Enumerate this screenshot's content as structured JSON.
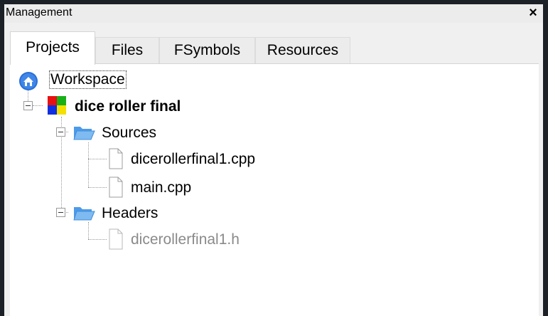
{
  "panel": {
    "title": "Management",
    "close_glyph": "×"
  },
  "tabs": [
    {
      "label": "Projects",
      "active": true
    },
    {
      "label": "Files",
      "active": false
    },
    {
      "label": "FSymbols",
      "active": false
    },
    {
      "label": "Resources",
      "active": false
    }
  ],
  "tree": {
    "workspace": {
      "label": "Workspace",
      "icon": "workspace-globe-icon"
    },
    "project": {
      "label": "dice roller final",
      "icon": "project-icon"
    },
    "sources": {
      "label": "Sources",
      "icon": "folder-icon",
      "files": [
        {
          "label": "dicerollerfinal1.cpp",
          "icon": "file-icon"
        },
        {
          "label": "main.cpp",
          "icon": "file-icon"
        }
      ]
    },
    "headers": {
      "label": "Headers",
      "icon": "folder-icon",
      "files": [
        {
          "label": "dicerollerfinal1.h",
          "icon": "file-icon"
        }
      ]
    }
  },
  "colors": {
    "outer_bg": "#1c2027",
    "panel_bg": "#f0f0f0",
    "workspace_icon": "#2a6fd6",
    "folder": "#3d8fe0",
    "project_red": "#e81010",
    "project_green": "#18b018",
    "project_blue": "#1030e0",
    "project_yellow": "#f4e000"
  }
}
